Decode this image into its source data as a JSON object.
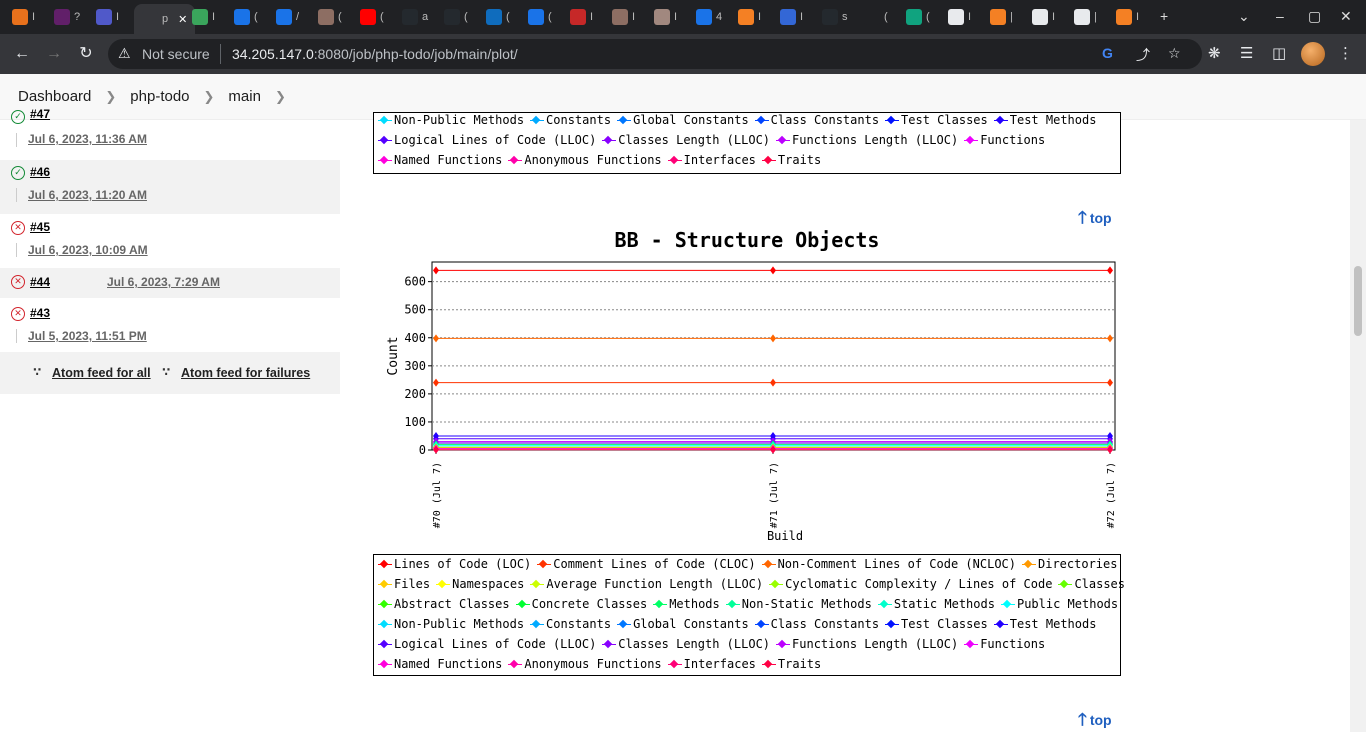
{
  "browser": {
    "tabs": [
      {
        "label": "I",
        "color": "#e8711c"
      },
      {
        "label": "?",
        "color": "#611f69"
      },
      {
        "label": "I",
        "color": "#5059c9"
      },
      {
        "label": "p",
        "color": "#35363a"
      },
      {
        "label": "I",
        "color": "#3aa55c"
      },
      {
        "label": "(",
        "color": "#1a73e8"
      },
      {
        "label": "/",
        "color": "#1a73e8"
      },
      {
        "label": "(",
        "color": "#8d6e63"
      },
      {
        "label": "(",
        "color": "#ff0000"
      },
      {
        "label": "a",
        "color": "#24292e"
      },
      {
        "label": "(",
        "color": "#24292e"
      },
      {
        "label": "(",
        "color": "#0f6cbd"
      },
      {
        "label": "(",
        "color": "#1a73e8"
      },
      {
        "label": "I",
        "color": "#c62828"
      },
      {
        "label": "I",
        "color": "#8d6e63"
      },
      {
        "label": "I",
        "color": "#a1887f"
      },
      {
        "label": "4",
        "color": "#1a73e8"
      },
      {
        "label": "I",
        "color": "#f48024"
      },
      {
        "label": "I",
        "color": "#3367d6"
      },
      {
        "label": "s",
        "color": "#24292e"
      },
      {
        "label": "(",
        "color": "#202124"
      },
      {
        "label": "(",
        "color": "#10a37f"
      },
      {
        "label": "I",
        "color": "#e8eaed"
      },
      {
        "label": "|",
        "color": "#f48024"
      },
      {
        "label": "I",
        "color": "#e8eaed"
      },
      {
        "label": "|",
        "color": "#e8eaed"
      },
      {
        "label": "I",
        "color": "#f48024"
      }
    ],
    "address": {
      "security_label": "Not secure",
      "host": "34.205.147.0",
      "rest": ":8080/job/php-todo/job/main/plot/"
    }
  },
  "breadcrumbs": [
    "Dashboard",
    "php-todo",
    "main"
  ],
  "builds": [
    {
      "number": "#47",
      "date": "Jul 6, 2023, 11:36 AM",
      "status": "success"
    },
    {
      "number": "#46",
      "date": "Jul 6, 2023, 11:20 AM",
      "status": "success"
    },
    {
      "number": "#45",
      "date": "Jul 6, 2023, 10:09 AM",
      "status": "failure"
    },
    {
      "number": "#44",
      "date": "Jul 6, 2023, 7:29 AM",
      "status": "failure"
    },
    {
      "number": "#43",
      "date": "Jul 5, 2023, 11:51 PM",
      "status": "failure"
    }
  ],
  "feeds": {
    "all": "Atom feed for all",
    "failures": "Atom feed for failures"
  },
  "top_link": "top",
  "legend": {
    "items": [
      {
        "name": "Lines of Code (LOC)",
        "color": "#ff0000"
      },
      {
        "name": "Comment Lines of Code (CLOC)",
        "color": "#ff3300"
      },
      {
        "name": "Non-Comment Lines of Code (NCLOC)",
        "color": "#ff6600"
      },
      {
        "name": "Directories",
        "color": "#ff9900"
      },
      {
        "name": "Files",
        "color": "#ffcc00"
      },
      {
        "name": "Namespaces",
        "color": "#ffff00"
      },
      {
        "name": "Average Function Length (LLOC)",
        "color": "#ccff00"
      },
      {
        "name": "Cyclomatic Complexity / Lines of Code",
        "color": "#99ff00"
      },
      {
        "name": "Classes",
        "color": "#66ff00"
      },
      {
        "name": "Abstract Classes",
        "color": "#33ff00"
      },
      {
        "name": "Concrete Classes",
        "color": "#00ff33"
      },
      {
        "name": "Methods",
        "color": "#00ff66"
      },
      {
        "name": "Non-Static Methods",
        "color": "#00ff99"
      },
      {
        "name": "Static Methods",
        "color": "#00ffcc"
      },
      {
        "name": "Public Methods",
        "color": "#00ffff"
      },
      {
        "name": "Non-Public Methods",
        "color": "#00ddff"
      },
      {
        "name": "Constants",
        "color": "#00aaff"
      },
      {
        "name": "Global Constants",
        "color": "#0077ff"
      },
      {
        "name": "Class Constants",
        "color": "#0044ff"
      },
      {
        "name": "Test Classes",
        "color": "#0011ff"
      },
      {
        "name": "Test Methods",
        "color": "#2200ff"
      },
      {
        "name": "Logical Lines of Code (LLOC)",
        "color": "#5500ff"
      },
      {
        "name": "Classes Length (LLOC)",
        "color": "#8800ff"
      },
      {
        "name": "Functions Length (LLOC)",
        "color": "#bb00ff"
      },
      {
        "name": "Functions",
        "color": "#ee00ff"
      },
      {
        "name": "Named Functions",
        "color": "#ff00dd"
      },
      {
        "name": "Anonymous Functions",
        "color": "#ff00aa"
      },
      {
        "name": "Interfaces",
        "color": "#ff0077"
      },
      {
        "name": "Traits",
        "color": "#ff0044"
      }
    ]
  },
  "chart_data": {
    "type": "line",
    "title": "BB - Structure Objects",
    "xlabel": "Build",
    "ylabel": "Count",
    "categories": [
      "#70 (Jul 7)",
      "#71 (Jul 7)",
      "#72 (Jul 7)"
    ],
    "ylim": [
      0,
      670
    ],
    "yticks": [
      0,
      100,
      200,
      300,
      400,
      500,
      600
    ],
    "grid": true,
    "series": [
      {
        "name": "Lines of Code (LOC)",
        "color": "#ff0000",
        "values": [
          640,
          640,
          640
        ]
      },
      {
        "name": "Comment Lines of Code (CLOC)",
        "color": "#ff3300",
        "values": [
          240,
          240,
          240
        ]
      },
      {
        "name": "Non-Comment Lines of Code (NCLOC)",
        "color": "#ff6600",
        "values": [
          398,
          398,
          398
        ]
      },
      {
        "name": "Logical Lines of Code (LLOC)",
        "color": "#5500ff",
        "values": [
          40,
          40,
          40
        ]
      },
      {
        "name": "Test Methods",
        "color": "#2200ff",
        "values": [
          50,
          50,
          50
        ]
      },
      {
        "name": "Functions Length (LLOC)",
        "color": "#bb00ff",
        "values": [
          30,
          30,
          30
        ]
      },
      {
        "name": "Classes Length (LLOC)",
        "color": "#8800ff",
        "values": [
          25,
          25,
          25
        ]
      },
      {
        "name": "Methods",
        "color": "#00ff66",
        "values": [
          20,
          20,
          20
        ]
      },
      {
        "name": "Public Methods",
        "color": "#00ffff",
        "values": [
          15,
          15,
          15
        ]
      },
      {
        "name": "Classes",
        "color": "#66ff00",
        "values": [
          10,
          10,
          10
        ]
      },
      {
        "name": "Files",
        "color": "#ffcc00",
        "values": [
          8,
          8,
          8
        ]
      },
      {
        "name": "Named Functions",
        "color": "#ff00dd",
        "values": [
          5,
          5,
          5
        ]
      },
      {
        "name": "Traits",
        "color": "#ff0044",
        "values": [
          1,
          1,
          1
        ]
      }
    ]
  }
}
